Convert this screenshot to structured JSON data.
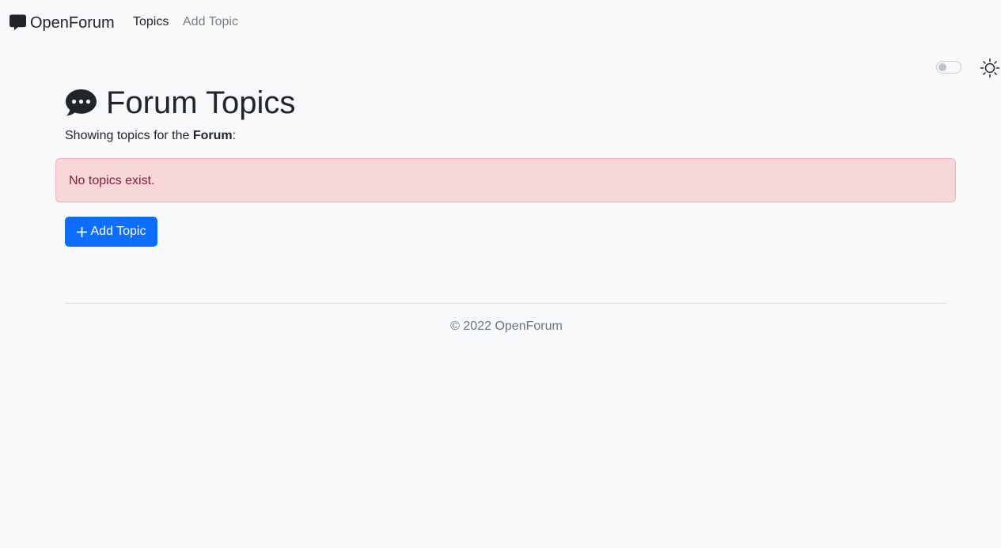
{
  "navbar": {
    "brand": "OpenForum",
    "brand_icon": "chat-square-icon",
    "links": [
      {
        "label": "Topics",
        "active": true
      },
      {
        "label": "Add Topic",
        "active": false
      }
    ]
  },
  "theme": {
    "toggle_on": false,
    "icon": "sun-icon"
  },
  "main": {
    "title": "Forum Topics",
    "title_icon": "chat-dots-icon",
    "subtitle_prefix": "Showing topics for the",
    "forum_name": "Forum",
    "subtitle_suffix": ":",
    "alert_text": "No topics exist.",
    "add_button_label": "Add Topic"
  },
  "footer": {
    "text": "© 2022 OpenForum"
  },
  "colors": {
    "background": "#f8f9fa",
    "primary": "#0d6efd",
    "alert_bg": "#f8d7da",
    "alert_text": "#842029",
    "muted": "#6c757d"
  }
}
